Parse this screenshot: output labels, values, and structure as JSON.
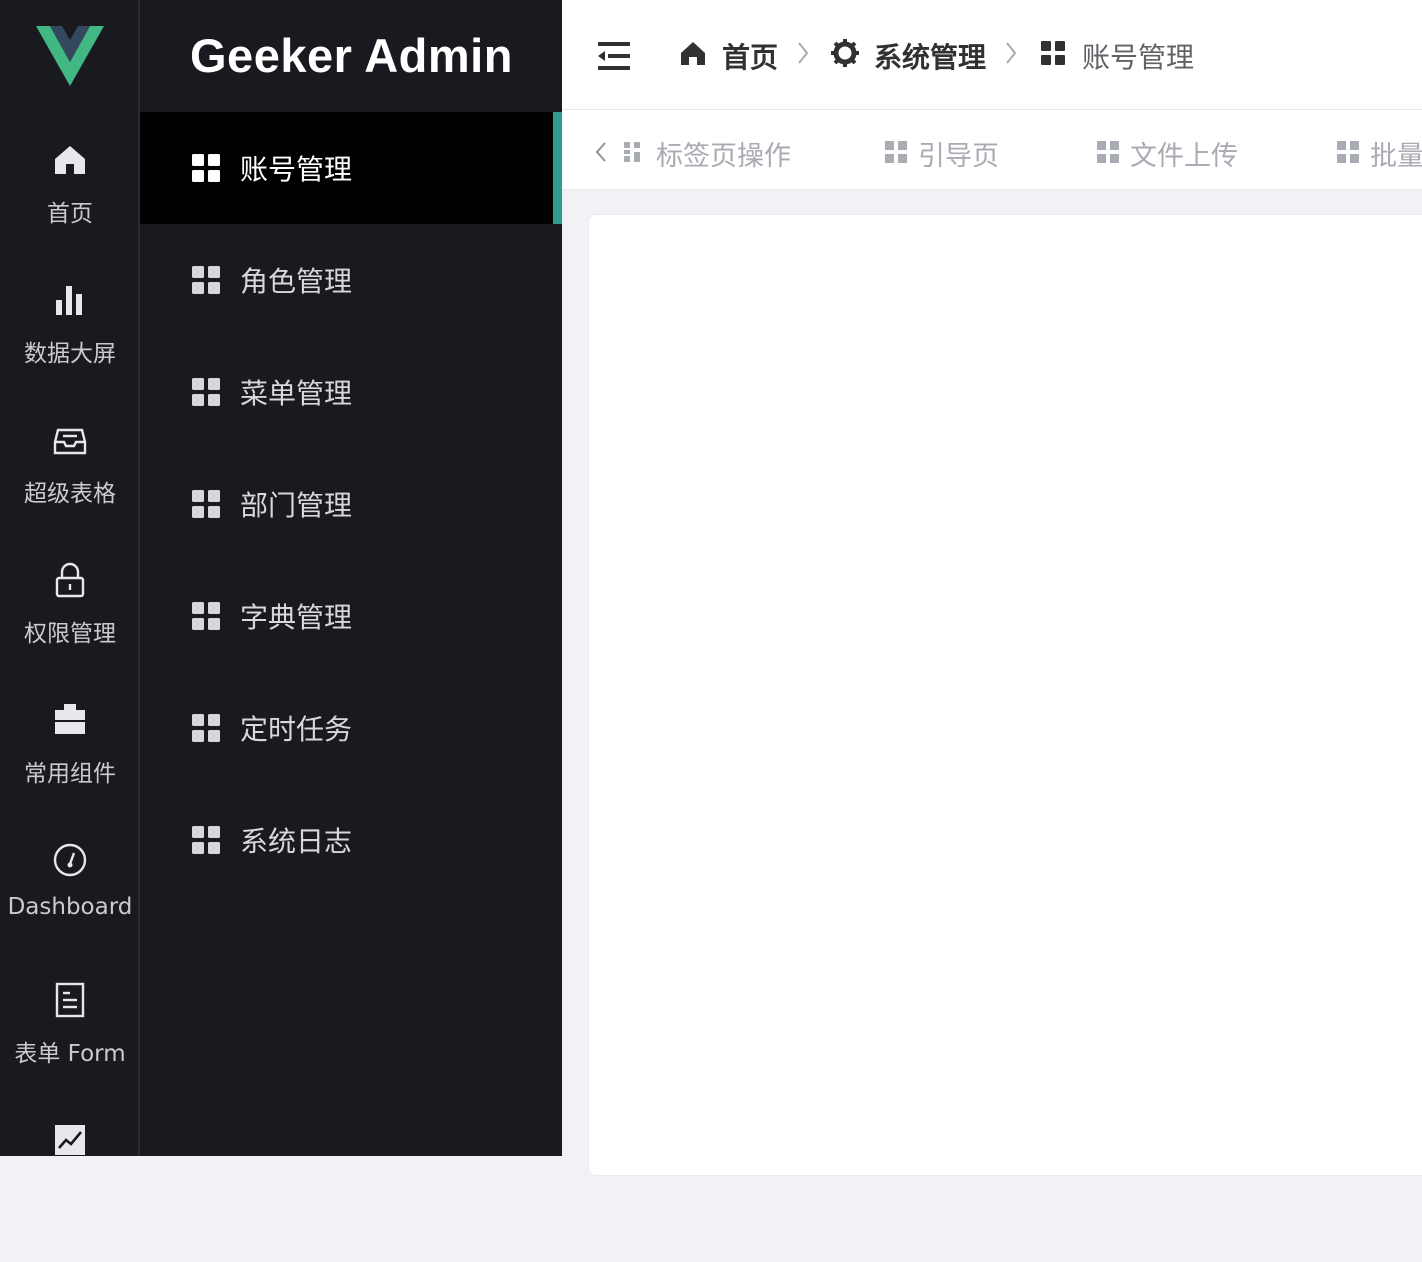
{
  "app": {
    "brand": "Geeker Admin"
  },
  "rail": [
    {
      "label": "首页",
      "icon": "home-icon"
    },
    {
      "label": "数据大屏",
      "icon": "bar-chart-icon"
    },
    {
      "label": "超级表格",
      "icon": "inbox-icon"
    },
    {
      "label": "权限管理",
      "icon": "lock-icon"
    },
    {
      "label": "常用组件",
      "icon": "briefcase-icon"
    },
    {
      "label": "Dashboard",
      "icon": "gauge-icon"
    },
    {
      "label": "表单 Form",
      "icon": "document-icon"
    },
    {
      "label": "",
      "icon": "trend-icon"
    }
  ],
  "submenu": [
    {
      "label": "账号管理",
      "active": true
    },
    {
      "label": "角色管理"
    },
    {
      "label": "菜单管理"
    },
    {
      "label": "部门管理"
    },
    {
      "label": "字典管理"
    },
    {
      "label": "定时任务"
    },
    {
      "label": "系统日志"
    }
  ],
  "breadcrumb": [
    {
      "label": "首页",
      "icon": "home-icon"
    },
    {
      "label": "系统管理",
      "icon": "gear-icon"
    },
    {
      "label": "账号管理",
      "icon": "grid-icon"
    }
  ],
  "tabs": [
    {
      "label": "标签页操作"
    },
    {
      "label": "引导页"
    },
    {
      "label": "文件上传"
    },
    {
      "label": "批量"
    }
  ],
  "colors": {
    "sidebar_bg": "#191a20",
    "active_bg": "#000000",
    "accent": "#2f9b8a",
    "logo_green": "#41b883",
    "logo_dark": "#35495e"
  }
}
